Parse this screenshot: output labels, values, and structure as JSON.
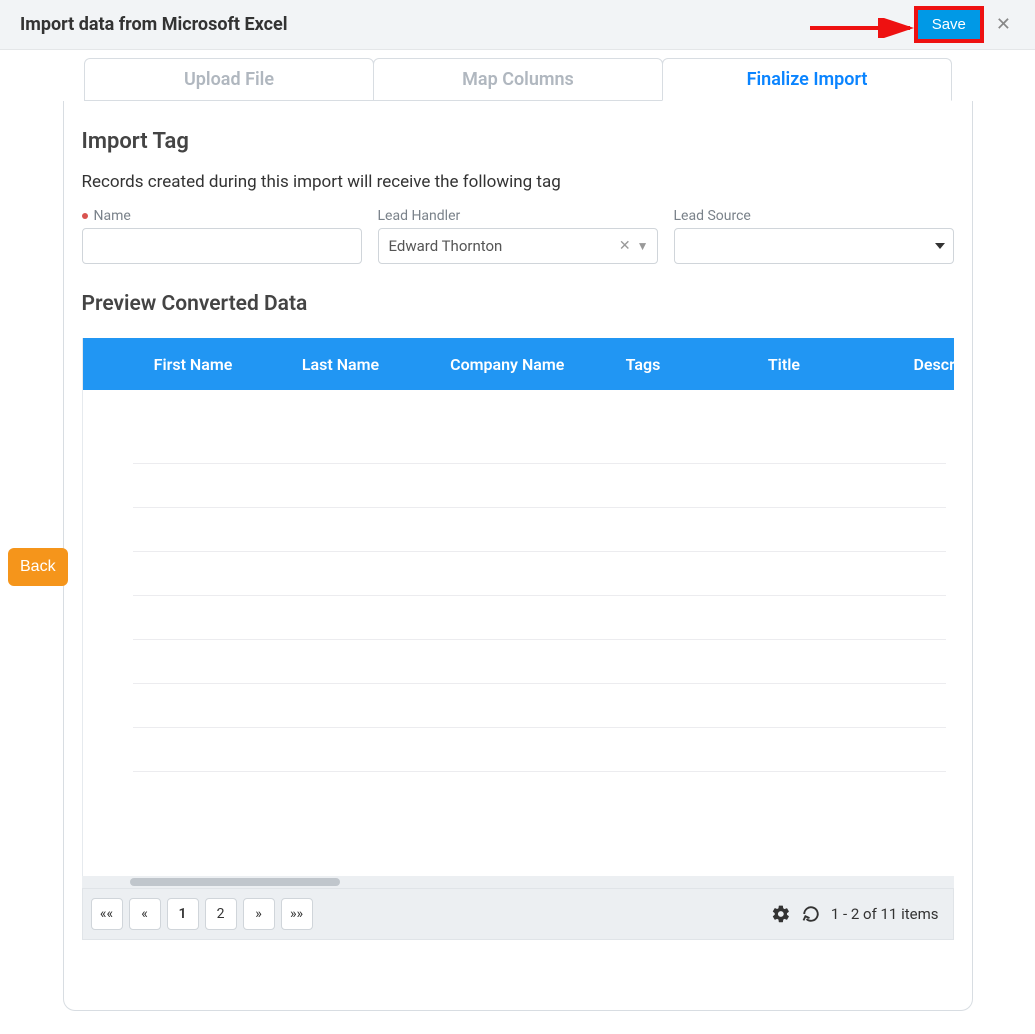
{
  "header": {
    "title": "Import data from Microsoft Excel",
    "save_label": "Save",
    "close_glyph": "✕"
  },
  "tabs": {
    "upload": "Upload File",
    "map": "Map Columns",
    "finalize": "Finalize Import"
  },
  "section": {
    "import_tag_title": "Import Tag",
    "import_tag_desc": "Records created during this import will receive the following tag"
  },
  "form": {
    "name_label": "Name",
    "name_value": "",
    "lead_handler_label": "Lead Handler",
    "lead_handler_value": "Edward Thornton",
    "lead_source_label": "Lead Source",
    "lead_source_value": ""
  },
  "preview": {
    "title": "Preview Converted Data",
    "columns": {
      "first_name": "First Name",
      "last_name": "Last Name",
      "company": "Company Name",
      "tags": "Tags",
      "title": "Title",
      "description": "Description"
    }
  },
  "pager": {
    "first": "««",
    "prev": "«",
    "p1": "1",
    "p2": "2",
    "next": "»",
    "last": "»»",
    "info": "1 - 2 of 11 items"
  },
  "back_label": "Back"
}
